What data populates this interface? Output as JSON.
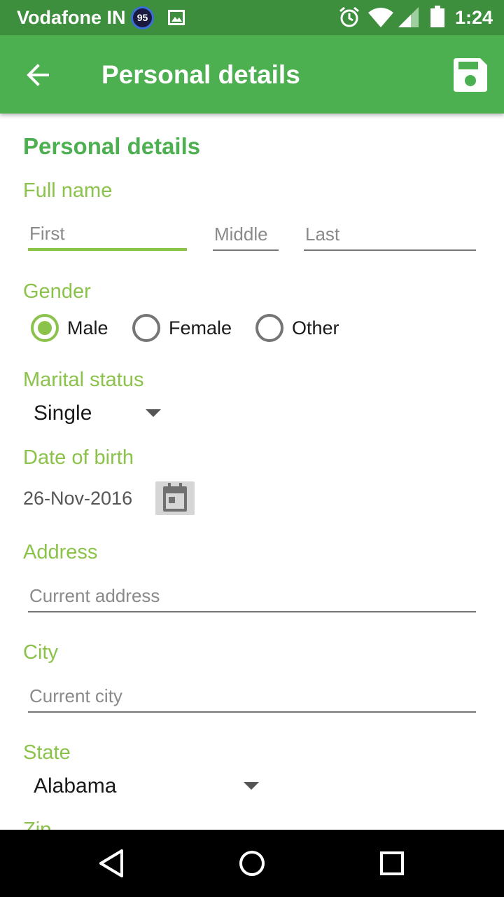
{
  "status_bar": {
    "carrier": "Vodafone IN",
    "notification_badge": "95",
    "time": "1:24",
    "icons": [
      "image-notification-icon",
      "alarm-icon",
      "wifi-icon",
      "signal-icon",
      "battery-icon"
    ]
  },
  "app_bar": {
    "title": "Personal details",
    "back_icon": "arrow-back-icon",
    "save_icon": "save-icon",
    "color": "#4caf50"
  },
  "form": {
    "section_title": "Personal details",
    "full_name": {
      "label": "Full name",
      "first_placeholder": "First",
      "middle_placeholder": "Middle",
      "last_placeholder": "Last"
    },
    "gender": {
      "label": "Gender",
      "options": [
        "Male",
        "Female",
        "Other"
      ],
      "selected": "Male"
    },
    "marital_status": {
      "label": "Marital status",
      "value": "Single"
    },
    "date_of_birth": {
      "label": "Date of birth",
      "value": "26-Nov-2016",
      "picker_icon": "calendar-icon"
    },
    "address": {
      "label": "Address",
      "placeholder": "Current address"
    },
    "city": {
      "label": "City",
      "placeholder": "Current city"
    },
    "state": {
      "label": "State",
      "value": "Alabama"
    },
    "zip": {
      "label": "Zip"
    }
  },
  "nav_bar": {
    "icons": [
      "back-triangle-icon",
      "home-circle-icon",
      "recents-square-icon"
    ]
  },
  "colors": {
    "primary": "#4caf50",
    "primary_dark": "#3d8f3e",
    "accent": "#8bc34a"
  }
}
